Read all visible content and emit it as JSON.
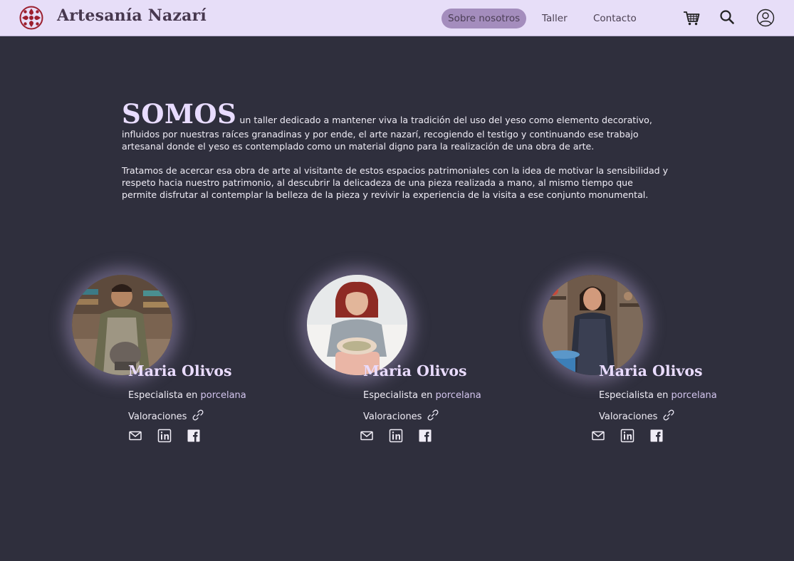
{
  "header": {
    "brand": "Artesanía Nazarí",
    "nav": [
      "Sobre nosotros",
      "Taller",
      "Contacto"
    ],
    "active_nav": "Sobre nosotros",
    "icons": [
      "cart-icon",
      "search-icon",
      "user-icon"
    ]
  },
  "intro": {
    "heading": "SOMOS",
    "paragraph1": "un taller dedicado a mantener viva la tradición del uso del yeso como elemento decorativo, influidos por nuestras raíces granadinas y por ende, el arte nazarí, recogiendo el testigo y continuando ese trabajo artesanal donde el yeso es contemplado como un material digno para la realización de una obra de arte.",
    "paragraph2": "Tratamos de acercar esa obra de arte al visitante de estos espacios patrimoniales con la idea de motivar la sensibilidad y respeto hacia nuestro patrimonio, al descubrir la delicadeza de una pieza realizada a mano, al mismo tiempo que permite disfrutar al contemplar la belleza de la pieza y revivir la experiencia de la visita a ese conjunto monumental."
  },
  "team": [
    {
      "name": "Maria Olivos",
      "role_prefix": "Especialista en",
      "role_accent": "porcelana",
      "ratings": "Valoraciones"
    },
    {
      "name": "Maria Olivos",
      "role_prefix": "Especialista en",
      "role_accent": "porcelana",
      "ratings": "Valoraciones"
    },
    {
      "name": "Maria Olivos",
      "role_prefix": "Especialista en",
      "role_accent": "porcelana",
      "ratings": "Valoraciones"
    }
  ],
  "colors": {
    "background": "#2f2f3d",
    "header": "#e7def8",
    "accent": "#a48dbd",
    "logo": "#9c1f2e",
    "name": "#eadcff"
  }
}
